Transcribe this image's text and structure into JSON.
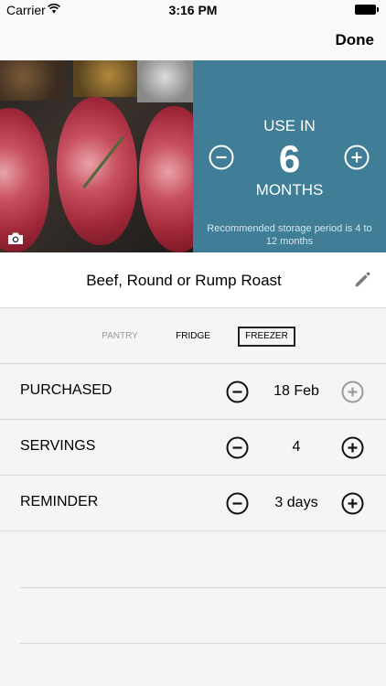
{
  "status_bar": {
    "carrier": "Carrier",
    "time": "3:16 PM"
  },
  "nav": {
    "done_label": "Done"
  },
  "usage": {
    "title": "USE IN",
    "value": "6",
    "unit": "MONTHS",
    "recommendation": "Recommended storage period is 4 to 12 months"
  },
  "item": {
    "name": "Beef, Round or Rump Roast"
  },
  "storage": {
    "options": [
      "PANTRY",
      "FRIDGE",
      "FREEZER"
    ],
    "selected": "FREEZER"
  },
  "rows": [
    {
      "label": "PURCHASED",
      "value": "18 Feb",
      "plus_enabled": false
    },
    {
      "label": "SERVINGS",
      "value": "4",
      "plus_enabled": true
    },
    {
      "label": "REMINDER",
      "value": "3 days",
      "plus_enabled": true
    }
  ],
  "colors": {
    "panel": "#3f7e96",
    "text": "#000000",
    "disabled": "#9a9a9a"
  },
  "icons": [
    "wifi-icon",
    "battery-icon",
    "camera-icon",
    "minus-circle-icon",
    "plus-circle-icon",
    "pencil-icon"
  ]
}
